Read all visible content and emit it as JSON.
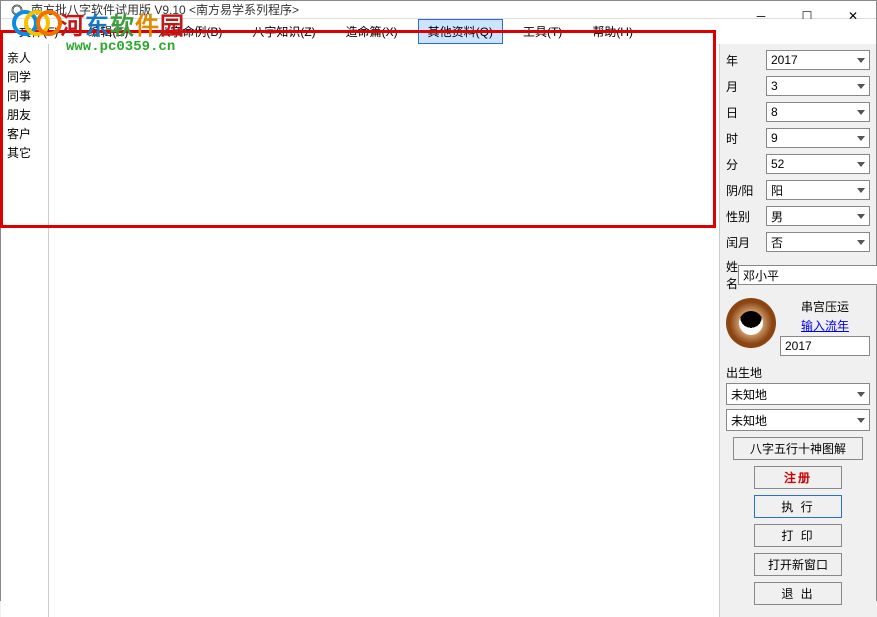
{
  "title": "南方批八字软件试用版 V9.10  <南方易学系列程序>",
  "menu": {
    "file": "文件(F)",
    "edit": "编辑(E)",
    "bazi_cases": "八字命例(B)",
    "bazi_knowledge": "八字知识(Z)",
    "zaoming": "造命篇(X)",
    "other_data": "其他资料(Q)",
    "tools": "工具(T)",
    "help": "帮助(H)"
  },
  "left_list": [
    "亲人",
    "同学",
    "同事",
    "朋友",
    "客户",
    "其它"
  ],
  "form": {
    "year_label": "年",
    "year_value": "2017",
    "month_label": "月",
    "month_value": "3",
    "day_label": "日",
    "day_value": "8",
    "hour_label": "时",
    "hour_value": "9",
    "minute_label": "分",
    "minute_value": "52",
    "yinyang_label": "阴/阳",
    "yinyang_value": "阳",
    "gender_label": "性别",
    "gender_value": "男",
    "leap_label": "闰月",
    "leap_value": "否",
    "name_label": "姓名",
    "name_value": "邓小平"
  },
  "bagua": {
    "title": "串宫压运",
    "link": "输入流年",
    "year_input": "2017"
  },
  "birthplace": {
    "label": "出生地",
    "value1": "未知地",
    "value2": "未知地"
  },
  "buttons": {
    "tujie": "八字五行十神图解",
    "register": "注册",
    "execute": "执 行",
    "print": "打 印",
    "new_window": "打开新窗口",
    "exit": "退 出"
  },
  "watermark": {
    "text1": "河",
    "text2": "东",
    "text3": "软",
    "text4": "件",
    "text5": "园",
    "url": "www.pc0359.cn"
  }
}
